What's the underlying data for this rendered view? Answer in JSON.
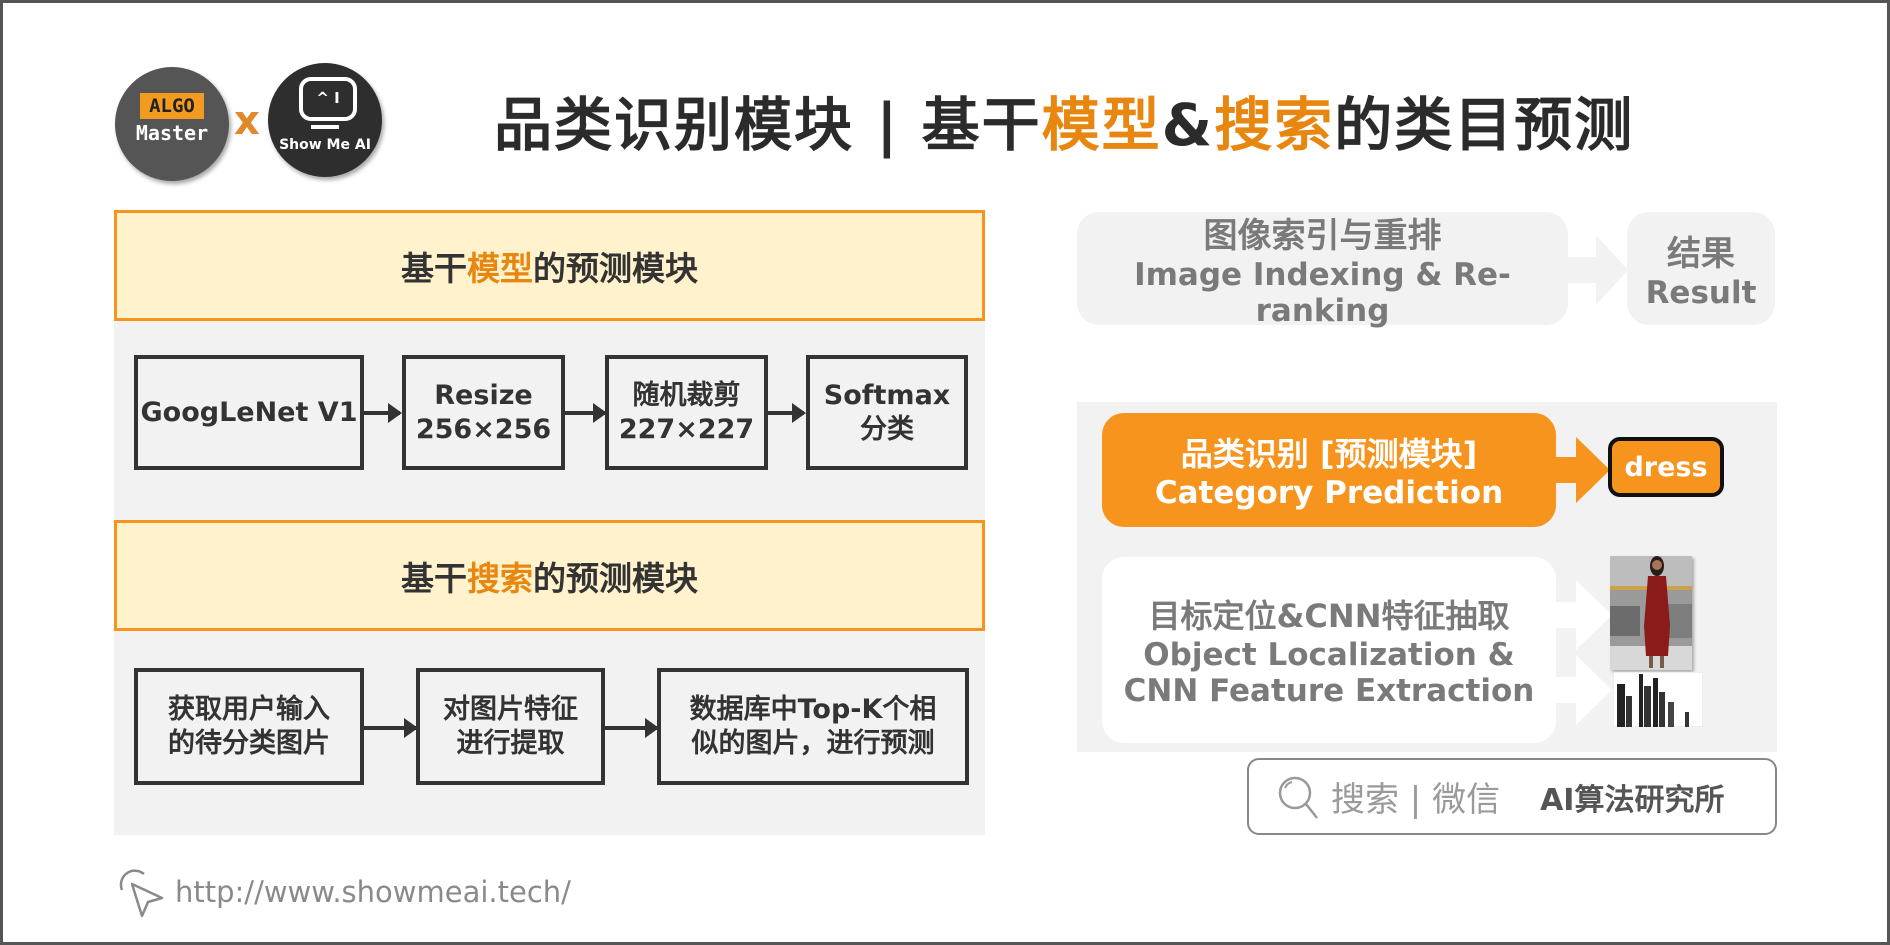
{
  "logos": {
    "algo_tag": "ALGO",
    "algo_master": "Master",
    "cross": "x",
    "showmeai_screen": "^ I",
    "showmeai_text": "Show Me AI"
  },
  "title": {
    "part1": "品类识别模块 | 基干",
    "highlight1": "模型",
    "amp": "&",
    "highlight2": "搜索",
    "part2": "的类目预测"
  },
  "model_module": {
    "header_pre": "基干",
    "header_highlight": "模型",
    "header_post": "的预测模块",
    "steps": [
      {
        "line1": "GoogLeNet V1",
        "line2": ""
      },
      {
        "line1": "Resize",
        "line2": "256×256"
      },
      {
        "line1": "随机裁剪",
        "line2": "227×227"
      },
      {
        "line1": "Softmax",
        "line2": "分类"
      }
    ]
  },
  "search_module": {
    "header_pre": "基干",
    "header_highlight": "搜索",
    "header_post": "的预测模块",
    "steps": [
      {
        "line1": "获取用户输入",
        "line2": "的待分类图片"
      },
      {
        "line1": "对图片特征",
        "line2": "进行提取"
      },
      {
        "line1": "数据库中Top-K个相",
        "line2": "似的图片，进行预测"
      }
    ]
  },
  "right_flow": {
    "indexing": {
      "zh": "图像索引与重排",
      "en": "Image Indexing & Re-ranking"
    },
    "result": {
      "zh": "结果",
      "en": "Result"
    },
    "category": {
      "zh": "品类识别 [预测模块]",
      "en": "Category Prediction"
    },
    "output_label": "dress",
    "localization": {
      "zh": "目标定位&CNN特征抽取",
      "en1": "Object Localization &",
      "en2": "CNN Feature Extraction"
    }
  },
  "search_badge": {
    "hint": "搜索 | 微信",
    "account": "AI算法研究所"
  },
  "footer": {
    "url": "http://www.showmeai.tech/"
  },
  "colors": {
    "accent": "#f7941d",
    "title_orange": "#e8870f",
    "header_fill": "#fff2cc",
    "panel_gray": "#f2f2f2"
  }
}
